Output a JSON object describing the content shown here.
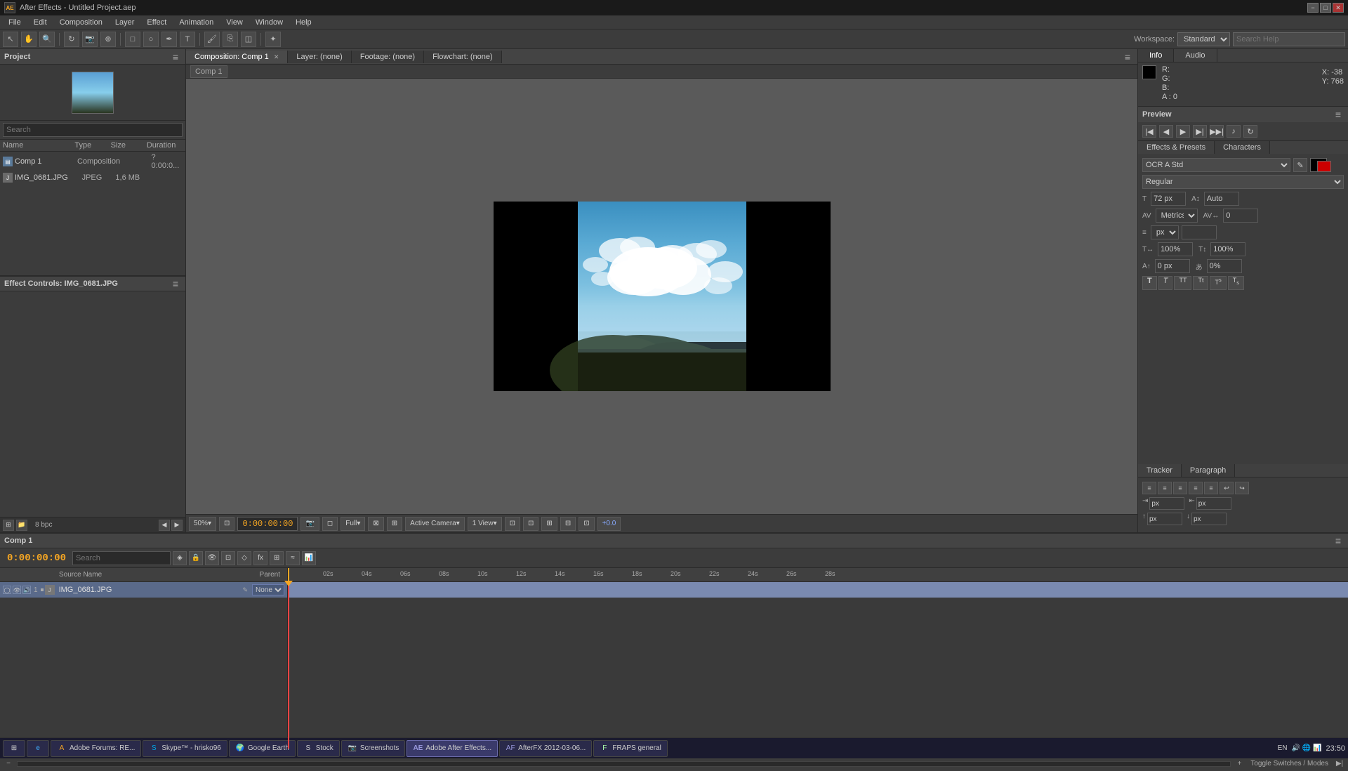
{
  "titlebar": {
    "title": "After Effects - Untitled Project.aep",
    "icon": "AE",
    "min_btn": "−",
    "max_btn": "□",
    "close_btn": "✕"
  },
  "menubar": {
    "items": [
      "File",
      "Edit",
      "Composition",
      "Layer",
      "Effect",
      "Animation",
      "View",
      "Window",
      "Help"
    ]
  },
  "toolbar": {
    "workspace_label": "Workspace:",
    "workspace_value": "Standard",
    "search_placeholder": "Search Help"
  },
  "project_panel": {
    "title": "Project",
    "menu_btn": "≡",
    "search_placeholder": "Search",
    "columns": [
      "Name",
      "Type",
      "Size",
      "Duration"
    ],
    "items": [
      {
        "name": "Comp 1",
        "type": "Composition",
        "size": "",
        "duration": "? 0:00:0..."
      },
      {
        "name": "IMG_0681.JPG",
        "type": "JPEG",
        "size": "1,6 MB",
        "duration": ""
      }
    ]
  },
  "effect_controls": {
    "title": "Effect Controls: IMG_0681.JPG"
  },
  "viewer_tabs": [
    {
      "label": "Composition: Comp 1",
      "active": true
    },
    {
      "label": "Layer: (none)",
      "active": false
    },
    {
      "label": "Footage: (none)",
      "active": false
    },
    {
      "label": "Flowchart: (none)",
      "active": false
    }
  ],
  "comp_breadcrumb": "Comp 1",
  "viewer_controls": {
    "zoom": "50%",
    "timecode": "0:00:00:00",
    "quality": "Full",
    "camera": "Active Camera",
    "view": "1 View",
    "extra": "+0.0"
  },
  "info_panel": {
    "tabs": [
      "Info",
      "Audio"
    ],
    "active_tab": "Info",
    "r": "R:",
    "g": "G:",
    "b": "B:",
    "a": "A : 0",
    "x": "X: -38",
    "y": "Y: 768"
  },
  "preview_panel": {
    "title": "Preview"
  },
  "effects_presets": {
    "title": "Effects & Presets",
    "tabs": [
      "Effects & Presets",
      "Characters"
    ],
    "active_tab": "Effects & Presets",
    "font_name": "OCR A Std",
    "font_style": "Regular",
    "font_size": "72 px",
    "font_size_auto": "Auto",
    "tracking": "Metrics",
    "tracking_val": "0",
    "line_spacing": "",
    "line_unit": "px",
    "scale_h": "100%",
    "scale_v": "100%",
    "baseline": "0 px",
    "tsukimi": "0%"
  },
  "tracker_panel": {
    "tabs": [
      "Tracker",
      "Paragraph"
    ],
    "active_tab": "Paragraph",
    "para_inputs": [
      "px",
      "px",
      "px",
      "px"
    ]
  },
  "timeline": {
    "title": "Comp 1",
    "timecode": "0:00:00:00",
    "ticks": [
      "02s",
      "04s",
      "06s",
      "08s",
      "10s",
      "12s",
      "14s",
      "16s",
      "18s",
      "20s",
      "22s",
      "24s",
      "26s",
      "28s"
    ],
    "layers": [
      {
        "number": "1",
        "name": "IMG_0681.JPG",
        "type": "jpeg"
      }
    ],
    "bottom_label": "Toggle Switches / Modes"
  },
  "taskbar": {
    "items": [
      {
        "label": "Start",
        "icon": "⊞",
        "active": false
      },
      {
        "label": "IE",
        "icon": "e",
        "active": false
      },
      {
        "label": "Adobe Forums: RE...",
        "icon": "A",
        "active": false
      },
      {
        "label": "Skype™ - hrisko96",
        "icon": "S",
        "active": false
      },
      {
        "label": "Google Earth",
        "icon": "🌍",
        "active": false
      },
      {
        "label": "Stock",
        "icon": "S",
        "active": false
      },
      {
        "label": "Screenshots",
        "icon": "📷",
        "active": false
      },
      {
        "label": "Adobe After Effects...",
        "icon": "AE",
        "active": true
      },
      {
        "label": "AfterFX 2012-03-06...",
        "icon": "AF",
        "active": false
      },
      {
        "label": "FRAPS general",
        "icon": "F",
        "active": false
      }
    ],
    "lang": "EN",
    "clock": "23:50"
  }
}
